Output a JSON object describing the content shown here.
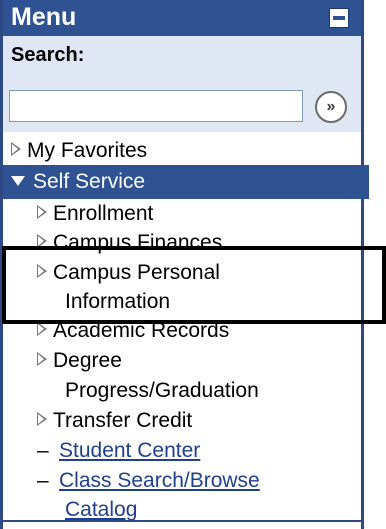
{
  "menu": {
    "title": "Menu",
    "search_label": "Search:",
    "search_value": "",
    "search_placeholder": "",
    "go_label": "»",
    "items": [
      {
        "label": "My Favorites"
      },
      {
        "label": "Self Service"
      },
      {
        "label": "Enrollment"
      },
      {
        "label": "Campus Finances"
      },
      {
        "label": "Campus Personal",
        "label2": "Information"
      },
      {
        "label": "Academic Records"
      },
      {
        "label": "Degree",
        "label2": "Progress/Graduation"
      },
      {
        "label": "Transfer Credit"
      },
      {
        "label": "Student Center"
      },
      {
        "label": "Class Search/Browse",
        "label2": "Catalog"
      }
    ]
  },
  "colors": {
    "title_bar": "#2e5292",
    "selected_bg": "#2e5292",
    "search_bg": "#dfe7f5",
    "link": "#1f3f8f"
  }
}
